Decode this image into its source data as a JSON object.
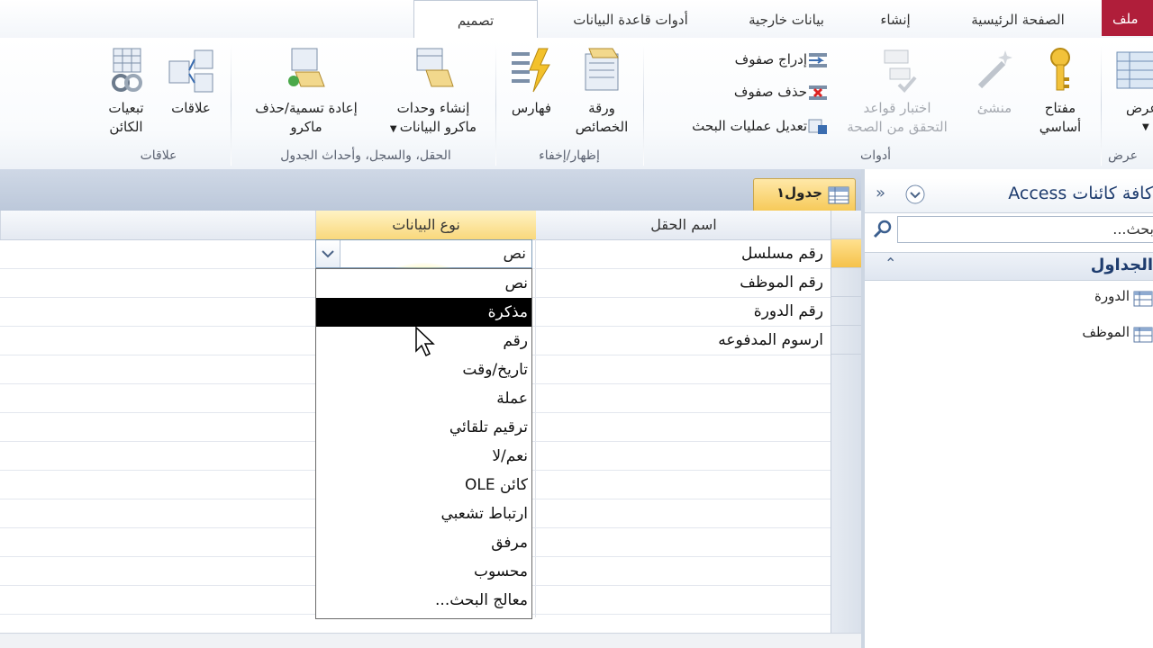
{
  "tabs": {
    "file": "ملف",
    "home": "الصفحة الرئيسية",
    "create": "إنشاء",
    "external": "بيانات خارجية",
    "dbtools": "أدوات قاعدة البيانات",
    "design": "تصميم"
  },
  "ribbon": {
    "view": "عرض",
    "primary_key_line1": "مفتاح",
    "primary_key_line2": "أساسي",
    "builder": "منشئ",
    "test_rules_line1": "اختبار قواعد",
    "test_rules_line2": "التحقق من الصحة",
    "insert_rows": "إدراج صفوف",
    "delete_rows": "حذف صفوف",
    "modify_lookups": "تعديل عمليات البحث",
    "property_sheet_line1": "ورقة",
    "property_sheet_line2": "الخصائص",
    "indexes": "فهارس",
    "create_macros_line1": "إنشاء وحدات",
    "create_macros_line2": "ماكرو البيانات",
    "rename_macro_line1": "إعادة تسمية/حذف",
    "rename_macro_line2": "ماكرو",
    "relationships": "علاقات",
    "dependencies_line1": "تبعيات",
    "dependencies_line2": "الكائن",
    "group_view": "عرض",
    "group_tools": "أدوات",
    "group_showhide": "إظهار/إخفاء",
    "group_events": "الحقل، والسجل، وأحداث الجدول",
    "group_relationships": "علاقات"
  },
  "document": {
    "tab_title": "جدول١",
    "col_field_name": "اسم الحقل",
    "col_data_type": "نوع البيانات",
    "rows": [
      {
        "name": "رقم مسلسل",
        "type": "نص"
      },
      {
        "name": "رقم الموظف",
        "type": ""
      },
      {
        "name": "رقم الدورة",
        "type": ""
      },
      {
        "name": "ارسوم المدفوعه",
        "type": ""
      }
    ],
    "combo_value": "نص",
    "dropdown_options": [
      "نص",
      "مذكرة",
      "رقم",
      "تاريخ/وقت",
      "عملة",
      "ترقيم تلقائي",
      "نعم/لا",
      "كائن OLE",
      "ارتباط تشعبي",
      "مرفق",
      "محسوب",
      "معالج البحث..."
    ],
    "selected_option": "مذكرة"
  },
  "nav": {
    "title": "كافة كائنات Access",
    "search_text": "بحث...",
    "group_title": "الجداول",
    "items": [
      "الدورة",
      "الموظف"
    ]
  },
  "colors": {
    "file_tab": "#b01e3a",
    "accent_tab": "#f6c957",
    "selection": "#000000"
  }
}
